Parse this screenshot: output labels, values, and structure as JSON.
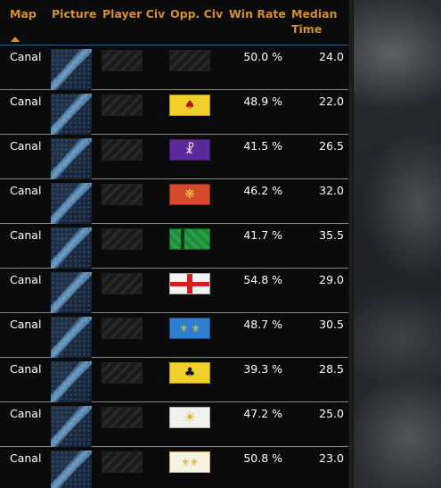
{
  "header": {
    "map": "Map",
    "picture": "Picture",
    "player_civ": "Player Civ",
    "opp_civ": "Opp. Civ",
    "win_rate": "Win Rate",
    "median_time_line1": "Median",
    "median_time_line2": "Time"
  },
  "rows": [
    {
      "map": "Canal",
      "opp_flag": "blank",
      "win_rate": "50.0 %",
      "median_time": "24.0"
    },
    {
      "map": "Canal",
      "opp_flag": "yellow-eagle",
      "win_rate": "48.9 %",
      "median_time": "22.0"
    },
    {
      "map": "Canal",
      "opp_flag": "purple-chi-rho",
      "win_rate": "41.5 %",
      "median_time": "26.5"
    },
    {
      "map": "Canal",
      "opp_flag": "red-knot",
      "win_rate": "46.2 %",
      "median_time": "32.0"
    },
    {
      "map": "Canal",
      "opp_flag": "green-striped",
      "win_rate": "41.7 %",
      "median_time": "35.5"
    },
    {
      "map": "Canal",
      "opp_flag": "st-george-cross",
      "win_rate": "54.8 %",
      "median_time": "29.0"
    },
    {
      "map": "Canal",
      "opp_flag": "blue-fleur-de-lis",
      "win_rate": "48.7 %",
      "median_time": "30.5"
    },
    {
      "map": "Canal",
      "opp_flag": "yellow-double-eagle",
      "win_rate": "39.3 %",
      "median_time": "28.5"
    },
    {
      "map": "Canal",
      "opp_flag": "white-sun",
      "win_rate": "47.2 %",
      "median_time": "25.0"
    },
    {
      "map": "Canal",
      "opp_flag": "white-fleur-de-lis",
      "win_rate": "50.8 %",
      "median_time": "23.0"
    }
  ],
  "colors": {
    "header_text": "#d4902d",
    "panel_bg": "#0b0b0b",
    "row_divider": "#8a8a8a",
    "header_divider": "#3a5a8a"
  }
}
